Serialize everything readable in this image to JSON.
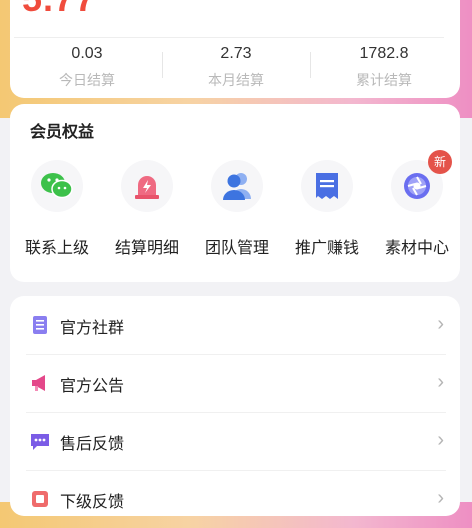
{
  "earnings": {
    "big_value": "5.77",
    "stats": [
      {
        "value": "0.03",
        "label": "今日结算"
      },
      {
        "value": "2.73",
        "label": "本月结算"
      },
      {
        "value": "1782.8",
        "label": "累计结算"
      }
    ]
  },
  "benefits": {
    "title": "会员权益",
    "items": [
      {
        "label": "联系上级",
        "icon": "wechat-icon",
        "color": "#3cc14a"
      },
      {
        "label": "结算明细",
        "icon": "alarm-light-icon",
        "color": "#e8536b"
      },
      {
        "label": "团队管理",
        "icon": "team-users-icon",
        "color": "#3d74e0"
      },
      {
        "label": "推广赚钱",
        "icon": "receipt-icon",
        "color": "#4a6fe3"
      },
      {
        "label": "素材中心",
        "icon": "aperture-icon",
        "color": "#6a6ef0"
      }
    ],
    "new_badge": "新"
  },
  "menu": {
    "items": [
      {
        "label": "官方社群",
        "icon": "notebook-icon",
        "color": "#8a7ef0"
      },
      {
        "label": "官方公告",
        "icon": "megaphone-icon",
        "color": "#e4488a"
      },
      {
        "label": "售后反馈",
        "icon": "chat-bubble-icon",
        "color": "#7b5ce6"
      },
      {
        "label": "下级反馈",
        "icon": "feedback-icon",
        "color": "#ef6b6b"
      }
    ],
    "chevron": "›"
  }
}
